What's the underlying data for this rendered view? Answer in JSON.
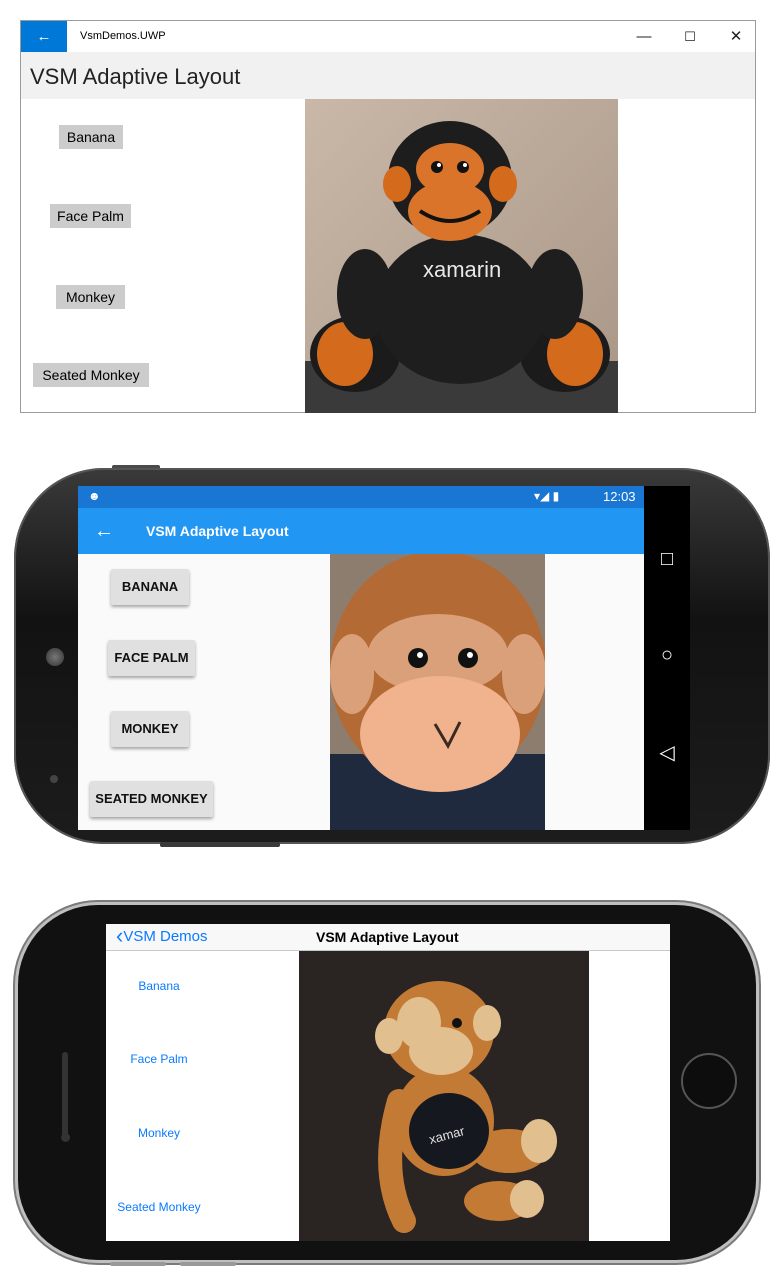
{
  "uwp": {
    "back_icon": "←",
    "app_title": "VsmDemos.UWP",
    "minimize_icon": "—",
    "maximize_icon": "☐",
    "close_icon": "✕",
    "heading": "VSM Adaptive Layout",
    "buttons": [
      "Banana",
      "Face Palm",
      "Monkey",
      "Seated Monkey"
    ],
    "photo_logo_text": "xamarin"
  },
  "android": {
    "status_icon": "☻",
    "signal_icon": "▾◢ ▮",
    "time": "12:03",
    "back_icon": "←",
    "title": "VSM Adaptive Layout",
    "buttons": [
      "BANANA",
      "FACE PALM",
      "MONKEY",
      "SEATED MONKEY"
    ],
    "nav_recent_icon": "□",
    "nav_home_icon": "○",
    "nav_back_icon": "◁",
    "accent": "#2196f3",
    "status_color": "#1976d2"
  },
  "ios": {
    "back_label": "VSM Demos",
    "back_chevron": "‹",
    "title": "VSM Adaptive Layout",
    "links": [
      "Banana",
      "Face Palm",
      "Monkey",
      "Seated Monkey"
    ],
    "photo_logo_text": "xamar",
    "tint": "#0a7aff"
  }
}
